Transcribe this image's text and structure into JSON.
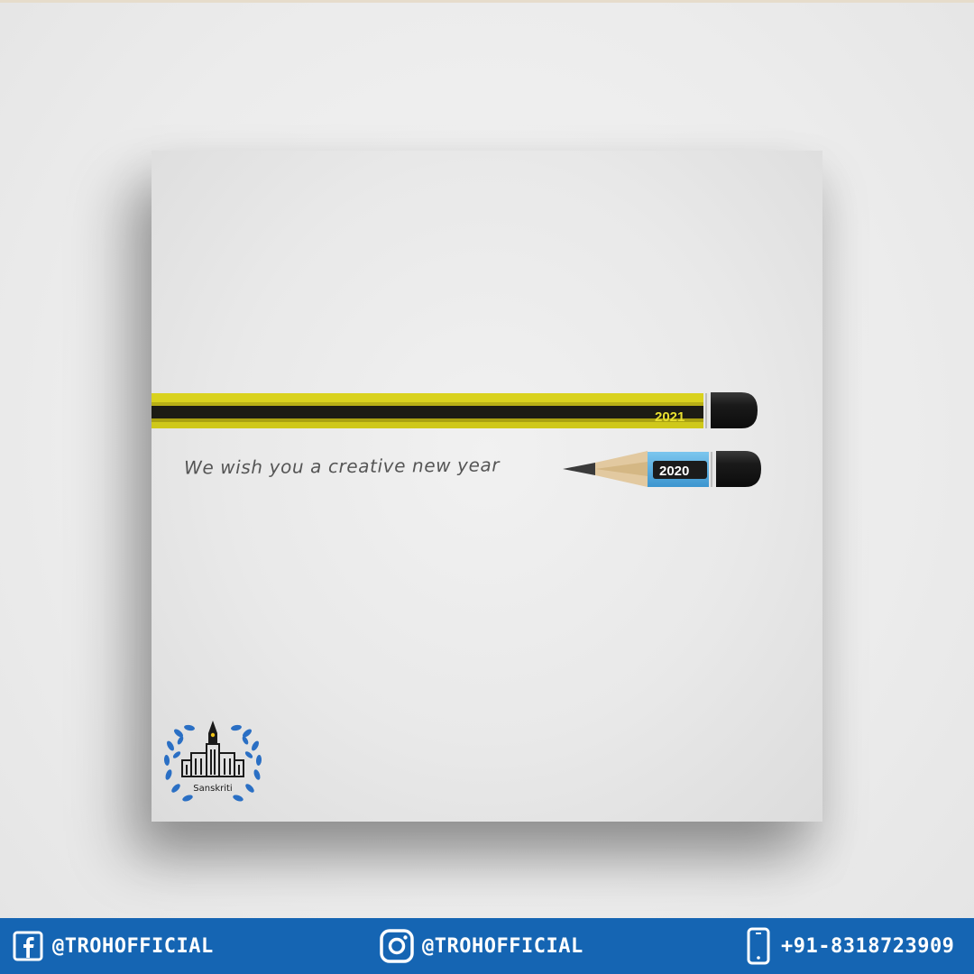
{
  "pencils": {
    "new_year_label": "2021",
    "old_year_label": "2020"
  },
  "message": "We wish you a creative new year",
  "logo": {
    "name": "Sanskriti"
  },
  "footer": {
    "facebook_handle": "@TROHOFFICIAL",
    "instagram_handle": "@TROHOFFICIAL",
    "phone": "+91-8318723909"
  },
  "colors": {
    "footer_bg": "#1565b3",
    "pencil_yellow": "#d9d21e",
    "pencil_blue": "#5fb3e6",
    "logo_blue": "#2a6fc4"
  }
}
